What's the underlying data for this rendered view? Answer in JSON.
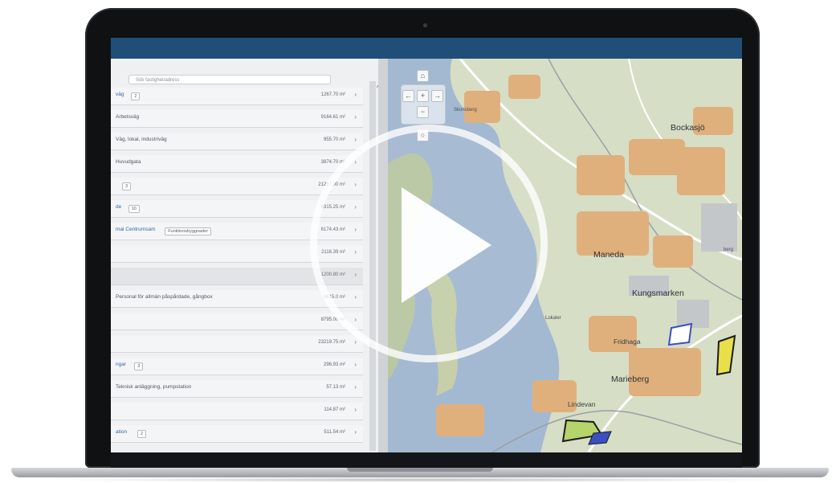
{
  "search": {
    "placeholder": "Sök fastighet/adress"
  },
  "list_rows": [
    {
      "name": "väg",
      "badge": "2",
      "area": "1267.70 m²",
      "link": true
    },
    {
      "name": "Arbetsväg",
      "badge": "",
      "area": "9164.61 m²",
      "link": false
    },
    {
      "name": "Väg, lokal, industriväg",
      "badge": "",
      "area": "955.70 m²",
      "link": false
    },
    {
      "name": "Huvudgata",
      "badge": "",
      "area": "3874.70 m²",
      "link": false
    },
    {
      "name": "",
      "badge": "3",
      "area": "21267.00 m²",
      "link": true
    },
    {
      "name": "de",
      "badge": "10",
      "area": "6315.25 m²",
      "link": true
    },
    {
      "name": "mal Centrumsam",
      "badge": "Funktionsbyggnader",
      "area": "6174.43 m²",
      "link": true
    },
    {
      "name": "",
      "badge": "",
      "area": "2116.39 m²",
      "link": false
    },
    {
      "name": "",
      "badge": "",
      "area": "1200.80 m²",
      "link": false
    },
    {
      "name": "Personal för allmän påspårdade, gångbox",
      "badge": "",
      "area": "8615.0 m²",
      "link": false
    },
    {
      "name": "",
      "badge": "",
      "area": "8795.00 m²",
      "link": false
    },
    {
      "name": "",
      "badge": "",
      "area": "23219.75 m²",
      "link": false
    },
    {
      "name": "ngar",
      "badge": "3",
      "area": "296.93 m²",
      "link": true
    },
    {
      "name": "Teknisk anläggning, pumpstation",
      "badge": "",
      "area": "57.13 m²",
      "link": false
    },
    {
      "name": "",
      "badge": "",
      "area": "114.87 m²",
      "link": false
    },
    {
      "name": "ation",
      "badge": "2",
      "area": "511.54 m²",
      "link": true
    }
  ],
  "row_arrow": "›",
  "map_labels": {
    "bockasjo": "Bockasjö",
    "maneda": "Maneda",
    "kungsmarken": "Kungsmarken",
    "fridhaga": "Fridhaga",
    "marieberg": "Marieberg",
    "lindevan": "Lindevan",
    "skonsberg": "Skonsberg",
    "lokaler": "Lokaler",
    "berg": "berg"
  },
  "nav": {
    "home": "⌂",
    "left": "←",
    "right": "→",
    "up": "↑",
    "zoom_in": "+",
    "zoom_out": "−",
    "reset": "○"
  },
  "scroll_up": "^",
  "colors": {
    "topbar": "#1f4e78",
    "water": "#9fb6cf",
    "land": "#d4dcc3",
    "buildings": "#e0b07c",
    "highlight_yellow": "#e8e04a",
    "highlight_green": "#b5d46a",
    "highlight_blue": "#3a4fc2"
  }
}
